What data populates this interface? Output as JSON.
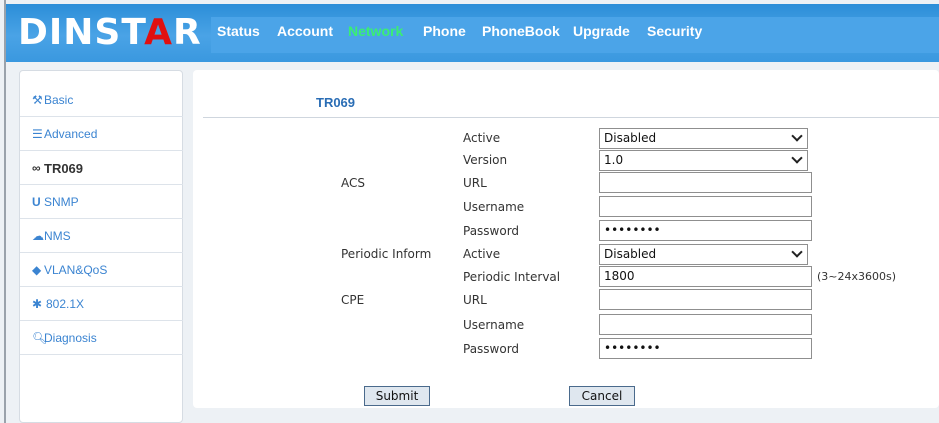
{
  "header": {
    "logo_prefix": "DINST",
    "logo_mid": "A",
    "logo_suffix": "R",
    "nav": [
      {
        "label": "Status"
      },
      {
        "label": "Account"
      },
      {
        "label": "Network"
      },
      {
        "label": "Phone"
      },
      {
        "label": "PhoneBook"
      },
      {
        "label": "Upgrade"
      },
      {
        "label": "Security"
      }
    ],
    "active_nav": "Network"
  },
  "sidebar": {
    "items": [
      {
        "label": "Basic",
        "icon": "wrench-icon"
      },
      {
        "label": "Advanced",
        "icon": "list-icon"
      },
      {
        "label": "TR069",
        "icon": "link-icon"
      },
      {
        "label": "SNMP",
        "icon": "magnet-icon"
      },
      {
        "label": "NMS",
        "icon": "cloud-icon"
      },
      {
        "label": "VLAN&QoS",
        "icon": "pin-icon"
      },
      {
        "label": "802.1X",
        "icon": "asterisk-icon"
      },
      {
        "label": "Diagnosis",
        "icon": "search-icon"
      }
    ],
    "active": "TR069"
  },
  "main": {
    "title": "TR069",
    "acs": {
      "group_label": "ACS",
      "active_label": "Active",
      "active_value": "Disabled",
      "version_label": "Version",
      "version_value": "1.0",
      "url_label": "URL",
      "url_value": "",
      "username_label": "Username",
      "username_value": "",
      "password_label": "Password",
      "password_value": "••••••••"
    },
    "periodic": {
      "group_label": "Periodic Inform",
      "active_label": "Active",
      "active_value": "Disabled",
      "interval_label": "Periodic Interval",
      "interval_value": "1800",
      "interval_hint": "(3~24x3600s)"
    },
    "cpe": {
      "group_label": "CPE",
      "url_label": "URL",
      "url_value": "",
      "username_label": "Username",
      "username_value": "",
      "password_label": "Password",
      "password_value": "••••••••"
    },
    "submit_label": "Submit",
    "cancel_label": "Cancel"
  },
  "colors": {
    "header_blue": "#2c8ed8",
    "nav_active": "#3aee74",
    "logo_accent": "#e01010",
    "link_blue": "#3b84d1",
    "title_blue": "#2a6db5"
  }
}
